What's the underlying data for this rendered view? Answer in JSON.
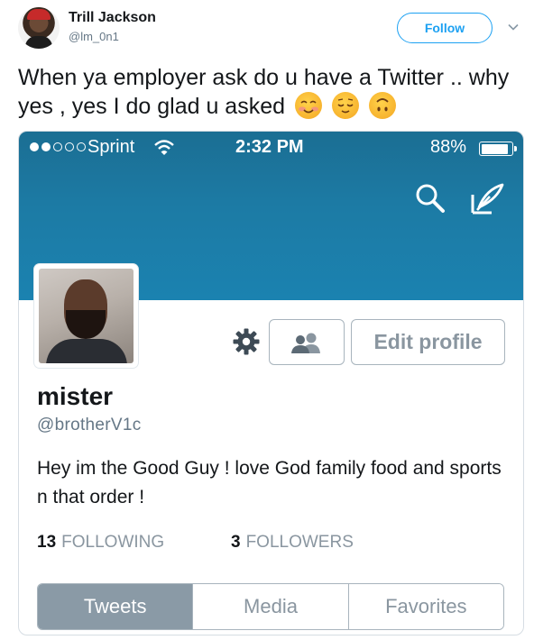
{
  "tweet": {
    "author_name": "Trill Jackson",
    "author_handle": "@lm_0n1",
    "follow_label": "Follow",
    "text": "When ya employer ask do u have a Twitter .. why yes , yes I do glad u asked",
    "emojis": [
      "smiling-face-with-blush-icon",
      "relieved-face-icon",
      "upside-down-face-icon"
    ]
  },
  "phone": {
    "carrier": "Sprint",
    "time": "2:32 PM",
    "battery": "88%",
    "signal_bars_filled": 2,
    "signal_bars_total": 5
  },
  "profile": {
    "name": "mister",
    "handle": "@brotherV1c",
    "bio": "Hey im the Good Guy ! love God family food and sports n that order !",
    "edit_label": "Edit profile",
    "following_count": "13",
    "following_label": "FOLLOWING",
    "followers_count": "3",
    "followers_label": "FOLLOWERS",
    "tabs": [
      {
        "label": "Tweets",
        "active": true
      },
      {
        "label": "Media",
        "active": false
      },
      {
        "label": "Favorites",
        "active": false
      }
    ]
  },
  "colors": {
    "banner": "#1b7ba6",
    "follow_accent": "#1da1f2",
    "active_tab": "#8a9aa6"
  }
}
